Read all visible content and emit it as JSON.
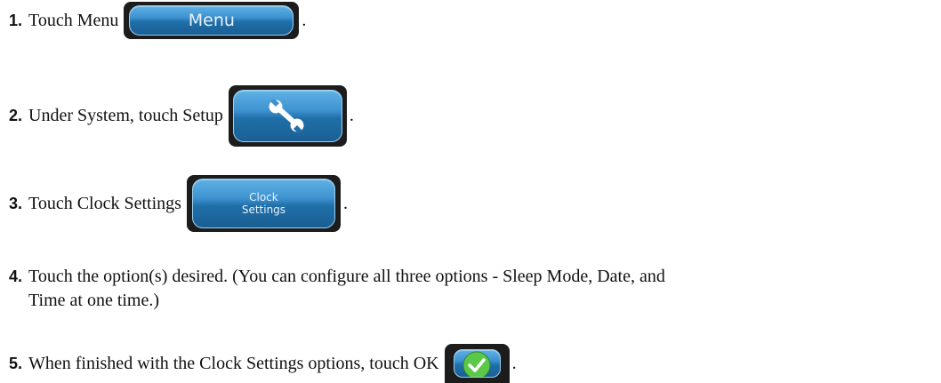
{
  "steps": [
    {
      "num": "1.",
      "text": "Touch Menu",
      "button_label": "Menu",
      "end": "."
    },
    {
      "num": "2.",
      "text": "Under System, touch Setup",
      "button_icon": "wrench-icon",
      "end": "."
    },
    {
      "num": "3.",
      "text": "Touch Clock Settings",
      "button_label_line1": "Clock",
      "button_label_line2": "Settings",
      "end": "."
    },
    {
      "num": "4.",
      "text_line1": "Touch the option(s) desired. (You can configure all three options - Sleep Mode, Date, and",
      "text_line2": "Time at one time.)"
    },
    {
      "num": "5.",
      "text": "When finished with the Clock Settings options, touch OK",
      "button_icon": "checkmark-icon",
      "end": "."
    }
  ],
  "colors": {
    "button_blue": "#3d91cf",
    "frame_dark": "#1c1c1c",
    "ok_green": "#5cc84a"
  }
}
